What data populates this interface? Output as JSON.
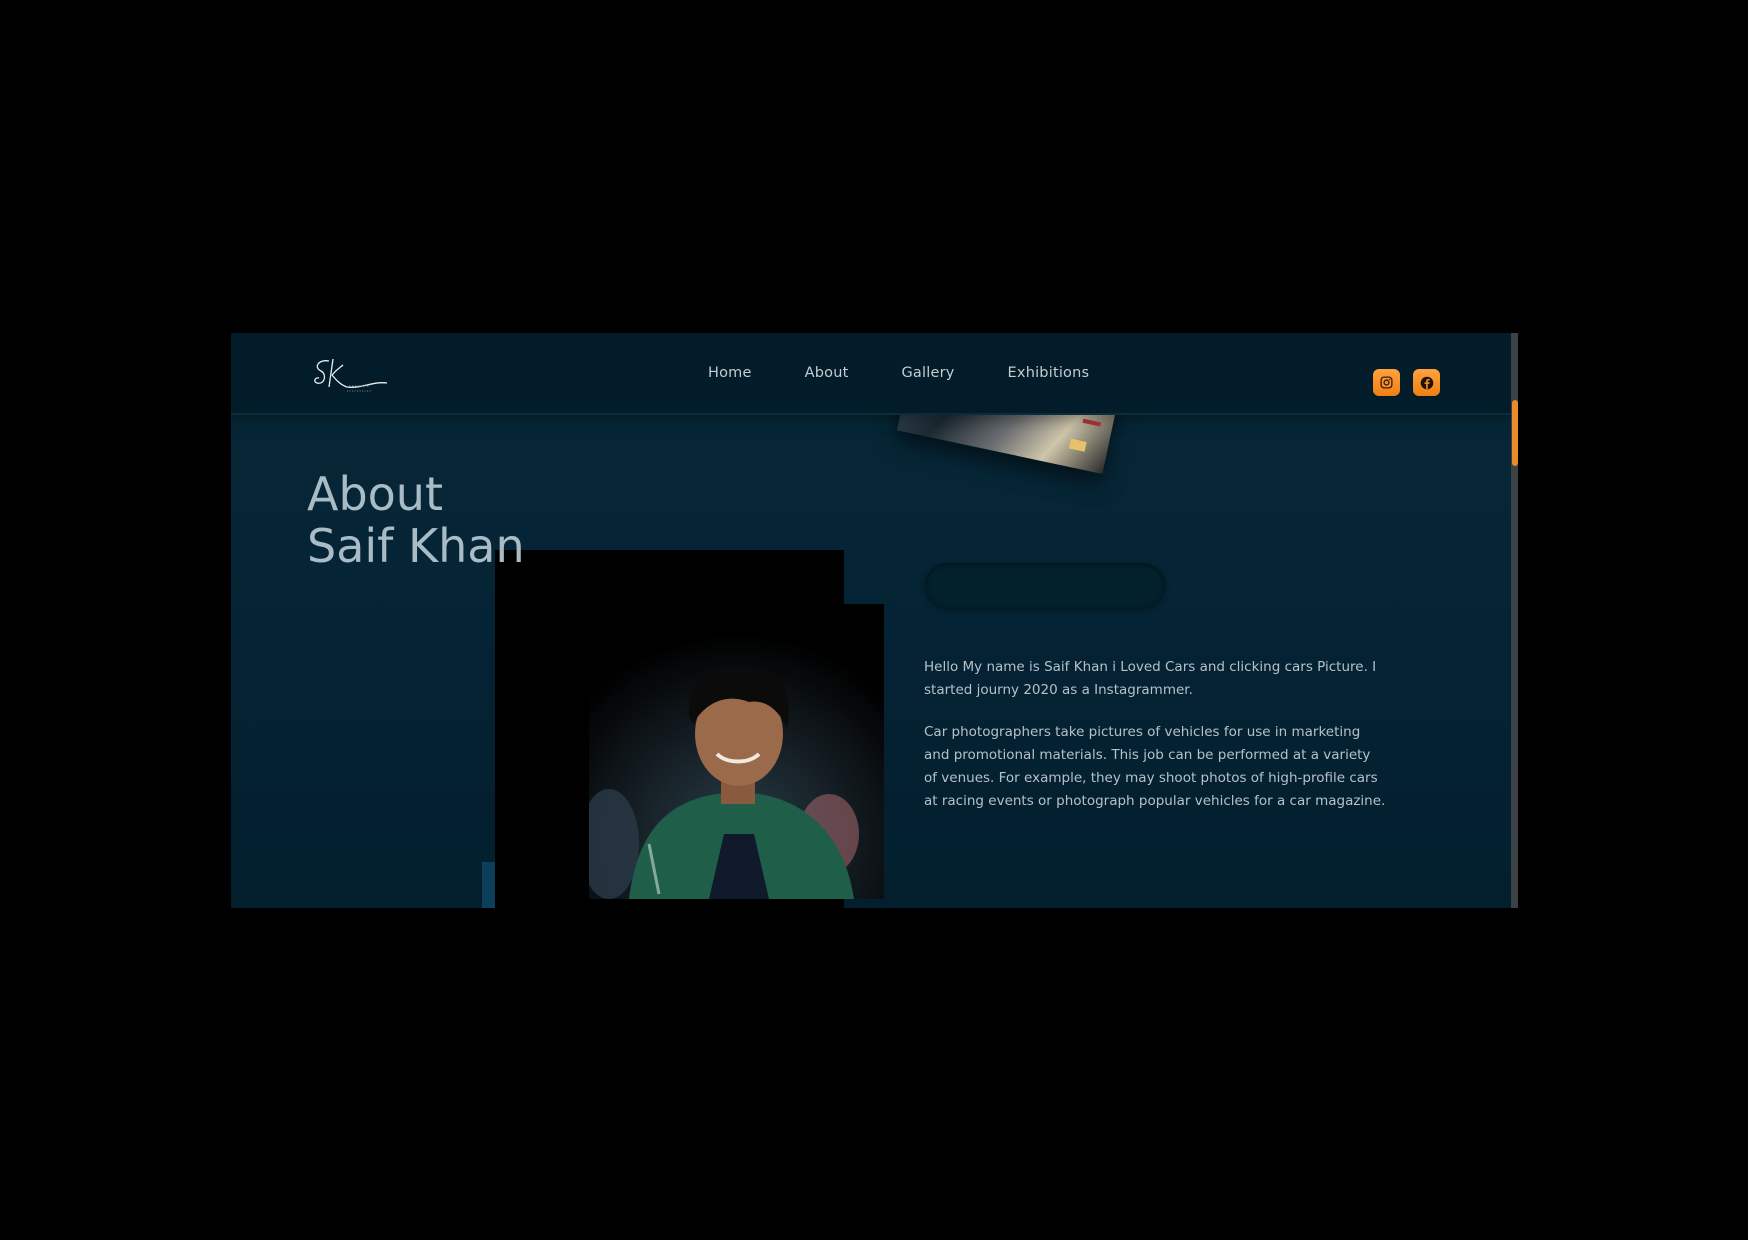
{
  "nav": {
    "logo_alt": "SK logo signature",
    "links": [
      "Home",
      "About",
      "Gallery",
      "Exhibitions"
    ]
  },
  "social": {
    "instagram_icon": "instagram-icon",
    "facebook_icon": "facebook-icon",
    "accent": "#f28a22"
  },
  "about": {
    "title_line1": "About",
    "title_line2": "Saif Khan"
  },
  "bio": {
    "paragraph1": "Hello My name is Saif Khan i Loved Cars and clicking cars Picture. I started journy 2020 as a Instagrammer.",
    "paragraph2": "Car photographers take pictures of vehicles for use in marketing and promotional materials. This job can be performed at a variety of venues. For example, they may shoot photos of high-profile cars at racing events or photograph popular vehicles for a car magazine."
  },
  "colors": {
    "background": "#042233",
    "navbar": "#031c29",
    "scroll_thumb": "#ea8a2a"
  }
}
